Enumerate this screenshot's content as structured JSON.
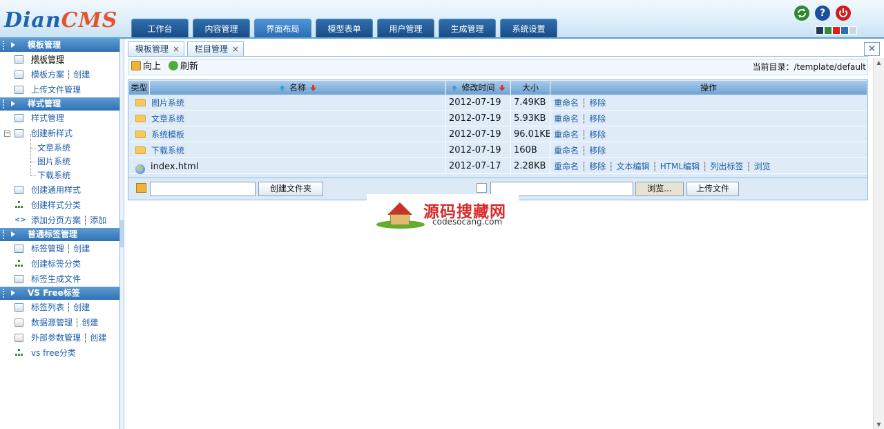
{
  "logo": {
    "part1": "Dian",
    "part2": "CMS"
  },
  "nav": [
    "工作台",
    "内容管理",
    "界面布局",
    "模型表单",
    "用户管理",
    "生成管理",
    "系统设置"
  ],
  "nav_active": 2,
  "top_icons": {
    "refresh": "refresh-icon",
    "help": "help-icon",
    "power": "power-icon",
    "help_glyph": "?"
  },
  "swatches": [
    "#1f3c5a",
    "#2e8b3a",
    "#e01e1e",
    "#2b6fb5",
    "#c8d8e6"
  ],
  "sidebar": {
    "sec1": {
      "title": "模板管理",
      "items": [
        {
          "label": "模板管理"
        },
        {
          "label": "模板方案",
          "extra": "创建"
        },
        {
          "label": "上传文件管理"
        }
      ]
    },
    "sec2": {
      "title": "样式管理",
      "items": [
        {
          "label": "样式管理"
        },
        {
          "label": "创建新样式"
        },
        {
          "label": "创建通用样式"
        },
        {
          "label": "创建样式分类"
        },
        {
          "label": "添加分页方案",
          "extra": "添加"
        }
      ],
      "subitems": [
        "文章系统",
        "图片系统",
        "下载系统"
      ],
      "collapse_glyph": "−"
    },
    "sec3": {
      "title": "普通标签管理",
      "items": [
        {
          "label": "标签管理",
          "extra": "创建"
        },
        {
          "label": "创建标签分类"
        },
        {
          "label": "标签生成文件"
        }
      ]
    },
    "sec4": {
      "title": "VS Free标签",
      "items": [
        {
          "label": "标签列表",
          "extra": "创建"
        },
        {
          "label": "数据源管理",
          "extra": "创建"
        },
        {
          "label": "外部参数管理",
          "extra": "创建"
        },
        {
          "label": "vs free分类"
        }
      ]
    },
    "sep": "┆",
    "arrow_glyph": "<>"
  },
  "tabs": [
    {
      "label": "模板管理",
      "close": "×"
    },
    {
      "label": "栏目管理",
      "close": "×"
    }
  ],
  "close_all": "✕",
  "toolbar": {
    "up": "向上",
    "refresh": "刷新",
    "current_dir_label": "当前目录：",
    "current_dir": "/template/default"
  },
  "table": {
    "headers": {
      "type": "类型",
      "name": "名称",
      "modified": "修改时间",
      "size": "大小",
      "ops": "操作"
    },
    "rows": [
      {
        "name": "图片系统",
        "date": "2012-07-19",
        "size": "7.49KB",
        "ops": [
          "重命名",
          "移除"
        ],
        "icon": "folder-icon"
      },
      {
        "name": "文章系统",
        "date": "2012-07-19",
        "size": "5.93KB",
        "ops": [
          "重命名",
          "移除"
        ],
        "icon": "folder-icon"
      },
      {
        "name": "系统模板",
        "date": "2012-07-19",
        "size": "96.01KB",
        "ops": [
          "重命名",
          "移除"
        ],
        "icon": "folder-icon"
      },
      {
        "name": "下载系统",
        "date": "2012-07-19",
        "size": "160B",
        "ops": [
          "重命名",
          "移除"
        ],
        "icon": "folder-icon"
      },
      {
        "name": "index.html",
        "date": "2012-07-17",
        "size": "2.28KB",
        "ops": [
          "重命名",
          "移除",
          "文本编辑",
          "HTML编辑",
          "列出标签",
          "浏览"
        ],
        "icon": "ie-file-icon",
        "ie_glyph": "e"
      }
    ]
  },
  "actions": {
    "create_folder": "创建文件夹",
    "browse": "浏览...",
    "upload": "上传文件",
    "folder_input_value": "",
    "file_input_value": ""
  },
  "watermark": {
    "cn": "源码搜藏网",
    "en": "codesocang.com"
  },
  "scroll": {
    "up": "▲",
    "down": "▼"
  }
}
